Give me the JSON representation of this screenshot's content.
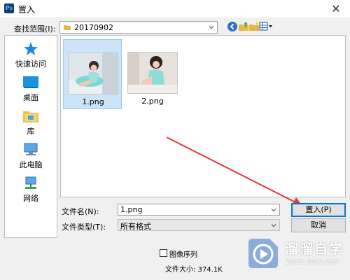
{
  "window": {
    "title": "置入",
    "app_icon_text": "Ps",
    "close_glyph": "✕"
  },
  "lookin": {
    "label": "查找范围(I):",
    "value": "20170902"
  },
  "toolbar": {
    "icons": [
      "back-icon",
      "up-folder-icon",
      "new-folder-icon",
      "view-menu-icon"
    ]
  },
  "places": [
    {
      "label": "快速访问",
      "icon": "star-icon"
    },
    {
      "label": "桌面",
      "icon": "desktop-icon"
    },
    {
      "label": "库",
      "icon": "library-icon"
    },
    {
      "label": "此电脑",
      "icon": "computer-icon"
    },
    {
      "label": "网络",
      "icon": "network-icon"
    }
  ],
  "files": [
    {
      "name": "1.png",
      "selected": true
    },
    {
      "name": "2.png",
      "selected": false
    }
  ],
  "form": {
    "filename_label": "文件名(N):",
    "filename_value": "1.png",
    "filetype_label": "文件类型(T):",
    "filetype_value": "所有格式"
  },
  "buttons": {
    "place": "置入(P)",
    "cancel": "取消"
  },
  "options": {
    "image_sequence_label": "图像序列",
    "image_sequence_checked": false
  },
  "filesize": "文件大小: 374.1K",
  "watermark": {
    "title": "溜溜自学",
    "url": "ZIXUE.3D66.COM"
  },
  "colors": {
    "selection": "#cce4f7",
    "annotation_arrow": "#e53935",
    "accent": "#0078d7"
  }
}
